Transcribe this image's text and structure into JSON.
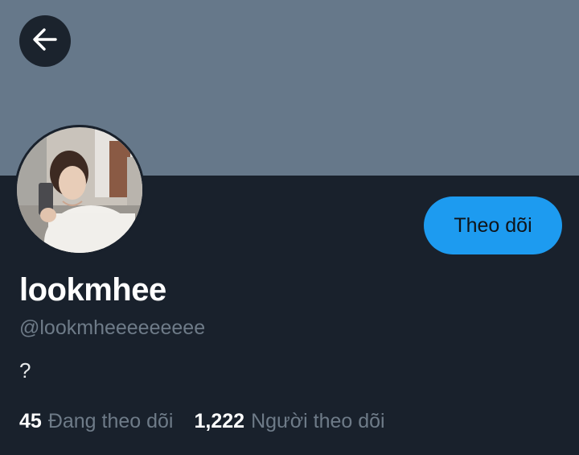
{
  "header": {
    "back_icon": "arrow-left-icon",
    "banner_color": "#66788a"
  },
  "profile": {
    "display_name": "lookmhee",
    "handle": "@lookmheeeeeeeee",
    "bio": "?",
    "follow_button_label": "Theo dõi",
    "accent_color": "#1d9bf0"
  },
  "stats": {
    "following_count": "45",
    "following_label": "Đang theo dõi",
    "followers_count": "1,222",
    "followers_label": "Người theo dõi"
  }
}
